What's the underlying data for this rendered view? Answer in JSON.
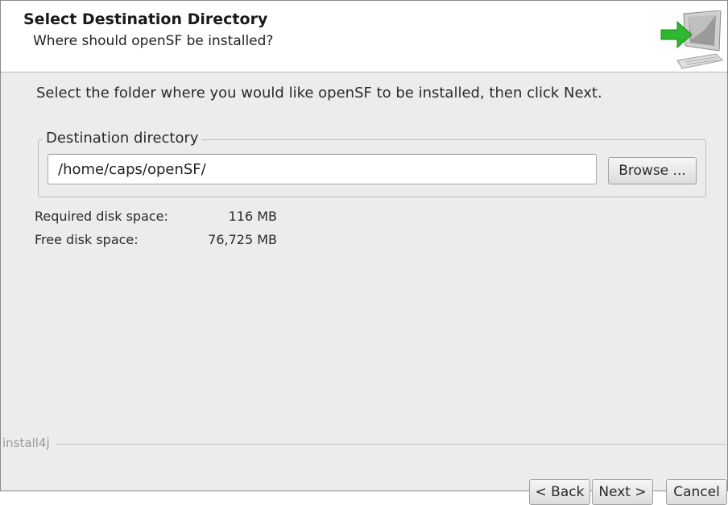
{
  "header": {
    "title": "Select Destination Directory",
    "subtitle": "Where should openSF be installed?",
    "icon": "installer-computer-arrow-icon"
  },
  "main": {
    "instruction": "Select the folder where you would like openSF to be installed, then click Next.",
    "destination": {
      "legend": "Destination directory",
      "path_value": "/home/caps/openSF/",
      "browse_label": "Browse ..."
    },
    "disk": {
      "required_label": "Required disk space:",
      "required_value": "116 MB",
      "free_label": "Free disk space:",
      "free_value": "76,725 MB"
    }
  },
  "footer": {
    "brand": "install4j",
    "back_label": "< Back",
    "next_label": "Next >",
    "cancel_label": "Cancel"
  },
  "colors": {
    "background": "#ececec",
    "header_background": "#ffffff",
    "arrow_green": "#2fb82f"
  }
}
